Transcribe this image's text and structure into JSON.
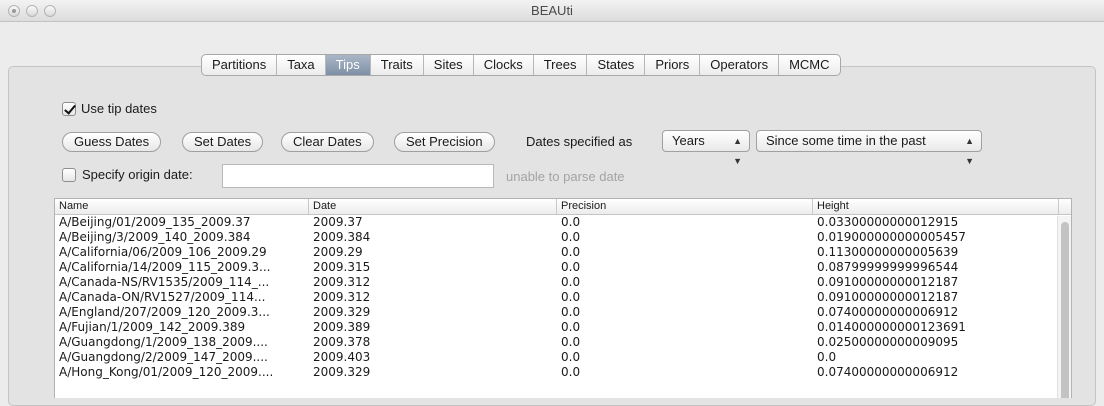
{
  "window": {
    "title": "BEAUti"
  },
  "tabs": [
    "Partitions",
    "Taxa",
    "Tips",
    "Traits",
    "Sites",
    "Clocks",
    "Trees",
    "States",
    "Priors",
    "Operators",
    "MCMC"
  ],
  "active_tab": "Tips",
  "tips": {
    "use_tip_dates_label": "Use tip dates",
    "use_tip_dates_checked": true,
    "buttons": {
      "guess": "Guess Dates",
      "set": "Set Dates",
      "clear": "Clear Dates",
      "precision": "Set Precision"
    },
    "dates_specified_label": "Dates specified as",
    "units_selected": "Years",
    "direction_selected": "Since some time in the past",
    "specify_origin_label": "Specify origin date:",
    "specify_origin_checked": false,
    "origin_value": "",
    "parse_message": "unable to parse date"
  },
  "table": {
    "headers": [
      "Name",
      "Date",
      "Precision",
      "Height"
    ],
    "rows": [
      [
        "A/Beijing/01/2009_135_2009.37",
        "2009.37",
        "0.0",
        "0.03300000000012915"
      ],
      [
        "A/Beijing/3/2009_140_2009.384",
        "2009.384",
        "0.0",
        "0.019000000000005457"
      ],
      [
        "A/California/06/2009_106_2009.29",
        "2009.29",
        "0.0",
        "0.11300000000005639"
      ],
      [
        "A/California/14/2009_115_2009.3...",
        "2009.315",
        "0.0",
        "0.08799999999996544"
      ],
      [
        "A/Canada-NS/RV1535/2009_114_...",
        "2009.312",
        "0.0",
        "0.09100000000012187"
      ],
      [
        "A/Canada-ON/RV1527/2009_114...",
        "2009.312",
        "0.0",
        "0.09100000000012187"
      ],
      [
        "A/England/207/2009_120_2009.3...",
        "2009.329",
        "0.0",
        "0.07400000000006912"
      ],
      [
        "A/Fujian/1/2009_142_2009.389",
        "2009.389",
        "0.0",
        "0.014000000000123691"
      ],
      [
        "A/Guangdong/1/2009_138_2009....",
        "2009.378",
        "0.0",
        "0.02500000000009095"
      ],
      [
        "A/Guangdong/2/2009_147_2009....",
        "2009.403",
        "0.0",
        "0.0"
      ],
      [
        "A/Hong_Kong/01/2009_120_2009....",
        "2009.329",
        "0.0",
        "0.07400000000006912"
      ]
    ]
  }
}
